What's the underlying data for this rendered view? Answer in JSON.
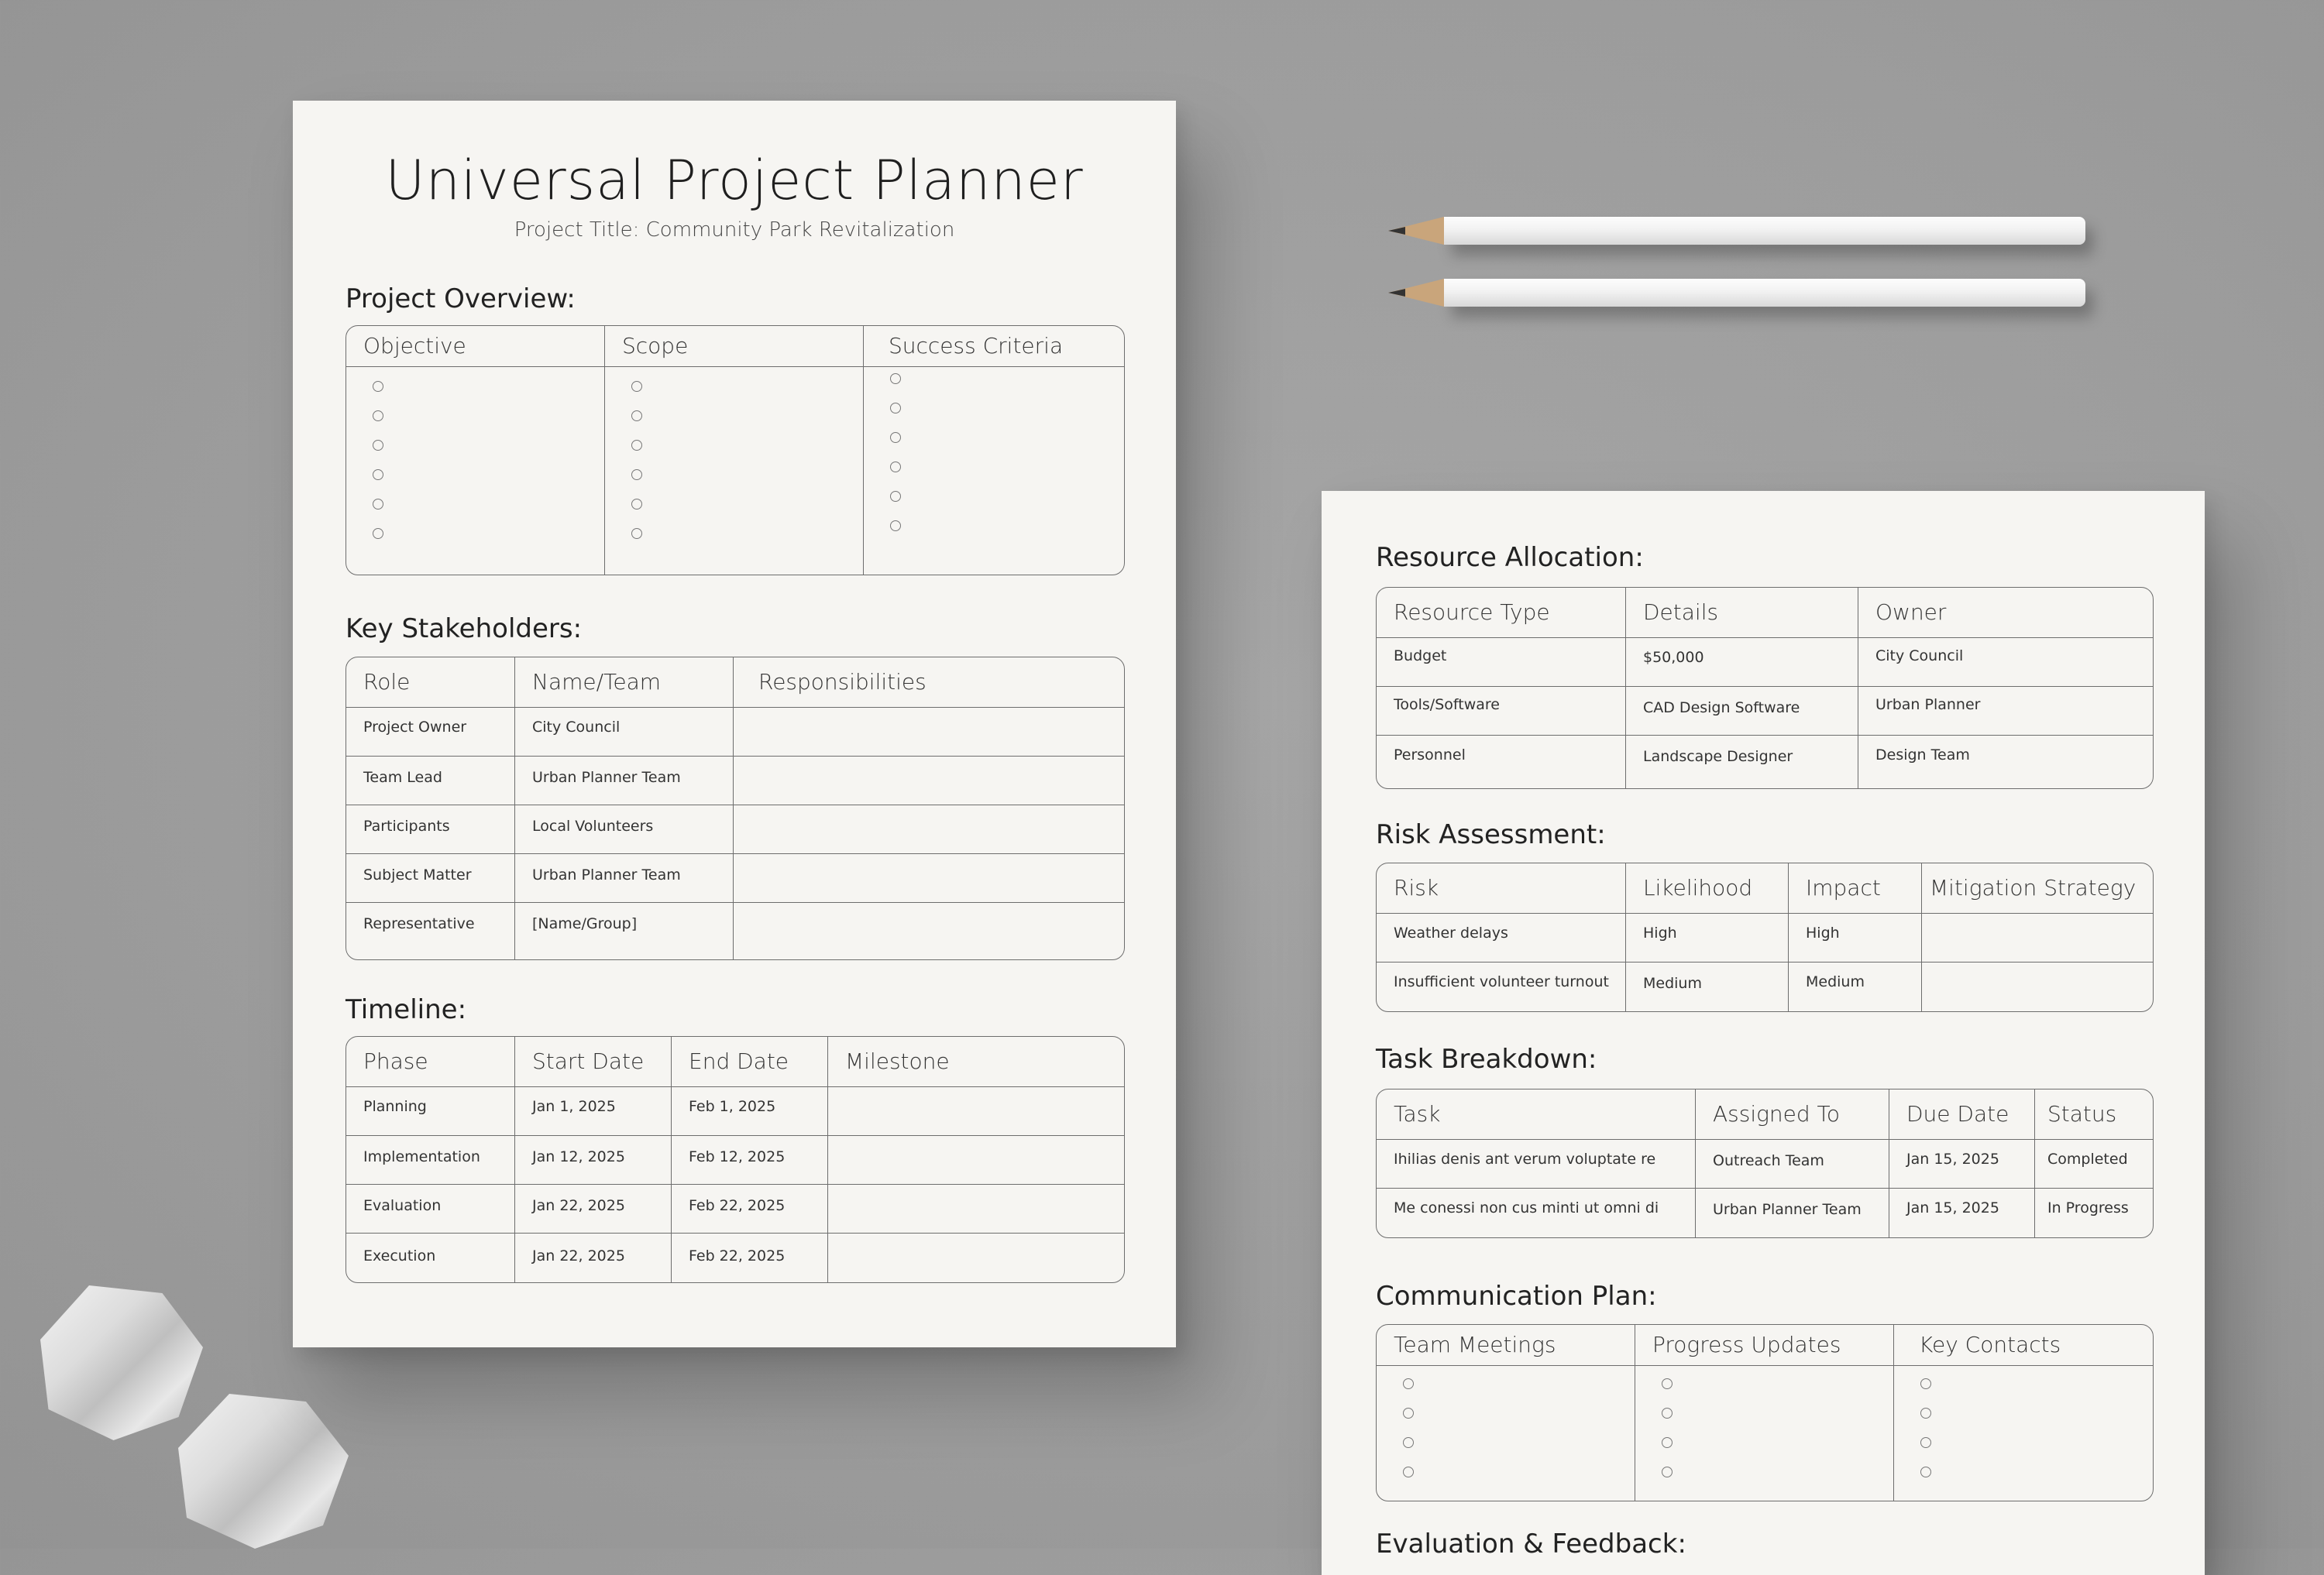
{
  "left_sheet": {
    "title": "Universal Project Planner",
    "subtitle": "Project Title: Community Park Revitalization",
    "overview": {
      "heading": "Project Overview:",
      "headers": [
        "Objective",
        "Scope",
        "Success Criteria"
      ]
    },
    "stakeholders": {
      "heading": "Key Stakeholders:",
      "headers": [
        "Role",
        "Name/Team",
        "Responsibilities"
      ],
      "rows": [
        [
          "Project Owner",
          "City Council",
          ""
        ],
        [
          "Team Lead",
          "Urban Planner Team",
          ""
        ],
        [
          "Participants",
          "Local Volunteers",
          ""
        ],
        [
          "Subject Matter",
          "Urban Planner Team",
          ""
        ],
        [
          "Representative",
          "[Name/Group]",
          ""
        ]
      ]
    },
    "timeline": {
      "heading": "Timeline:",
      "headers": [
        "Phase",
        "Start Date",
        "End Date",
        "Milestone"
      ],
      "rows": [
        [
          "Planning",
          "Jan 1, 2025",
          "Feb 1, 2025",
          ""
        ],
        [
          "Implementation",
          "Jan 12, 2025",
          "Feb 12, 2025",
          ""
        ],
        [
          "Evaluation",
          "Jan 22, 2025",
          "Feb 22, 2025",
          ""
        ],
        [
          "Execution",
          "Jan 22, 2025",
          "Feb 22, 2025",
          ""
        ]
      ]
    }
  },
  "right_sheet": {
    "resources": {
      "heading": "Resource Allocation:",
      "headers": [
        "Resource Type",
        "Details",
        "Owner"
      ],
      "rows": [
        [
          "Budget",
          "$50,000",
          "City Council"
        ],
        [
          "Tools/Software",
          "CAD Design Software",
          "Urban Planner"
        ],
        [
          "Personnel",
          "Landscape Designer",
          "Design Team"
        ]
      ]
    },
    "risks": {
      "heading": "Risk Assessment:",
      "headers": [
        "Risk",
        "Likelihood",
        "Impact",
        "Mitigation Strategy"
      ],
      "rows": [
        [
          "Weather delays",
          "High",
          "High",
          ""
        ],
        [
          "Insufficient volunteer turnout",
          "Medium",
          "Medium",
          ""
        ]
      ]
    },
    "tasks": {
      "heading": "Task Breakdown:",
      "headers": [
        "Task",
        "Assigned To",
        "Due Date",
        "Status"
      ],
      "rows": [
        [
          "Ihilias denis ant verum voluptate re",
          "Outreach Team",
          "Jan 15, 2025",
          "Completed"
        ],
        [
          "Me conessi non cus minti ut omni di",
          "Urban Planner Team",
          "Jan 15, 2025",
          "In Progress"
        ]
      ]
    },
    "communication": {
      "heading": "Communication Plan:",
      "headers": [
        "Team Meetings",
        "Progress Updates",
        "Key Contacts"
      ]
    },
    "next_heading": "Evaluation & Feedback:"
  }
}
